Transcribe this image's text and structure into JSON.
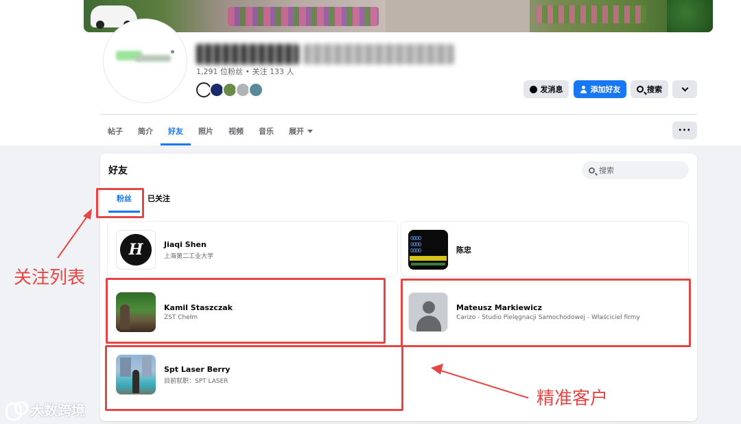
{
  "profile": {
    "stats": "1,291 位粉丝 • 关注 133 人",
    "actions": {
      "message_label": "发消息",
      "add_friend_label": "添加好友",
      "search_label": "搜索"
    }
  },
  "tabs": [
    {
      "label": "帖子"
    },
    {
      "label": "简介"
    },
    {
      "label": "好友"
    },
    {
      "label": "照片"
    },
    {
      "label": "视频"
    },
    {
      "label": "音乐"
    },
    {
      "label": "展开"
    }
  ],
  "tabs_more_label": "···",
  "friends_section": {
    "title": "好友",
    "search_placeholder": "搜索",
    "subtabs": [
      "粉丝",
      "已关注"
    ],
    "friends": [
      {
        "name": "Jiaqi Shen",
        "subtitle": "上海第二工业大学"
      },
      {
        "name": "陈忠",
        "subtitle": ""
      },
      {
        "name": "Kamil Staszczak",
        "subtitle": "ZST Chełm"
      },
      {
        "name": "Mateusz Markiewicz",
        "subtitle": "Carizo - Studio Pielęgnacji Samochodowej - Właściciel firmy"
      },
      {
        "name": "Spt Laser Berry",
        "subtitle": "目前就职：SPT LASER"
      }
    ]
  },
  "annotations": {
    "following_list": "关注列表",
    "target_customers": "精准客户"
  },
  "watermark": "大数跨境",
  "colors": {
    "accent": "#1877f2",
    "annotation": "#e64545",
    "page_background": "#f0f2f5"
  }
}
